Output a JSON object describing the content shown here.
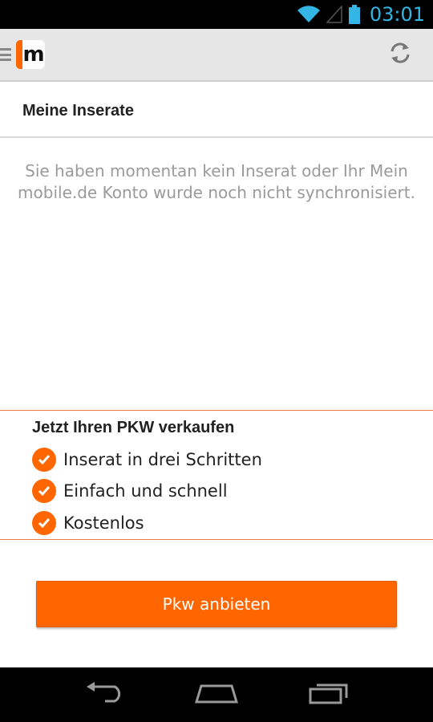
{
  "status_bar": {
    "time": "03:01",
    "icons": [
      "wifi-icon",
      "signal-icon",
      "battery-icon"
    ]
  },
  "action_bar": {
    "logo_letter": "m",
    "icons": [
      "drawer-icon",
      "refresh-icon"
    ]
  },
  "main": {
    "section_title": "Meine Inserate",
    "empty_message": "Sie haben momentan kein Inserat oder Ihr Mein mobile.de Konto wurde noch nicht synchronisiert."
  },
  "promo": {
    "title": "Jetzt Ihren PKW verkaufen",
    "items": [
      {
        "label": "Inserat in drei Schritten"
      },
      {
        "label": "Einfach und schnell"
      },
      {
        "label": "Kostenlos"
      }
    ],
    "button_label": "Pkw anbieten"
  },
  "colors": {
    "accent": "#ff6600",
    "status_time": "#33b5e5"
  },
  "nav_bar": {
    "icons": [
      "back-icon",
      "home-icon",
      "recent-apps-icon"
    ]
  }
}
